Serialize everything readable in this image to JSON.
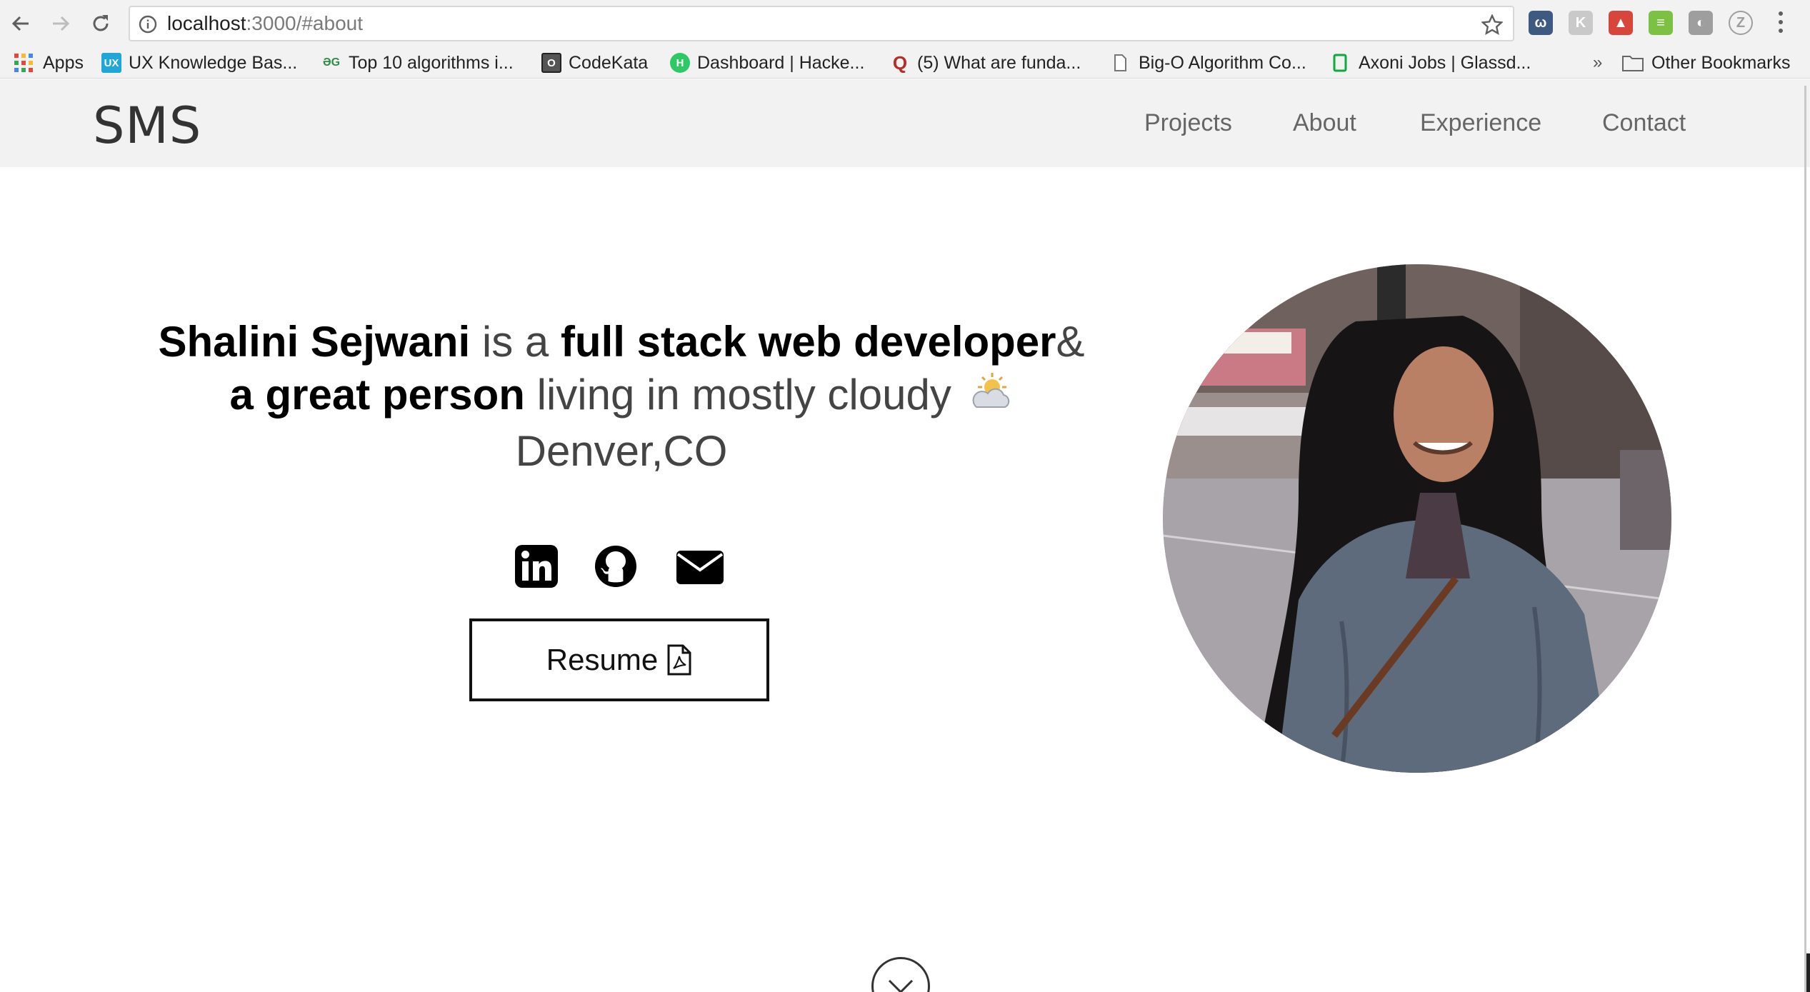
{
  "browser": {
    "url_host": "localhost",
    "url_rest": ":3000/#about",
    "bookmarks": [
      {
        "label": "Apps",
        "icon": "apps-grid-icon"
      },
      {
        "label": "UX Knowledge Bas...",
        "icon": "ux-icon",
        "badge": "UX"
      },
      {
        "label": "Top 10 algorithms i...",
        "icon": "geeksforgeeks-icon",
        "badge": "ƏG"
      },
      {
        "label": "CodeKata",
        "icon": "codekata-icon",
        "badge": "O"
      },
      {
        "label": "Dashboard | Hacke...",
        "icon": "hackerrank-icon",
        "badge": "H"
      },
      {
        "label": "(5) What are funda...",
        "icon": "quora-icon",
        "badge": "Q"
      },
      {
        "label": "Big-O Algorithm Co...",
        "icon": "page-icon"
      },
      {
        "label": "Axoni Jobs | Glassd...",
        "icon": "glassdoor-icon"
      }
    ],
    "overflow_label": "»",
    "other_bookmarks": "Other Bookmarks"
  },
  "site": {
    "logo": "SMS",
    "nav": [
      "Projects",
      "About",
      "Experience",
      "Contact"
    ],
    "headline": {
      "name": "Shalini Sejwani",
      "part1": " is a ",
      "role": "full stack web developer",
      "amp": "&",
      "trait": "a great person",
      "part2": " living in mostly cloudy ",
      "city": "Denver,CO"
    },
    "resume_label": "Resume",
    "social_icons": [
      "linkedin-icon",
      "github-icon",
      "email-icon"
    ]
  },
  "colors": {
    "chrome_bg": "#f2f2f2",
    "nav_bg": "#f2f2f2",
    "text_dark": "#000000",
    "nav_text": "#666666"
  }
}
